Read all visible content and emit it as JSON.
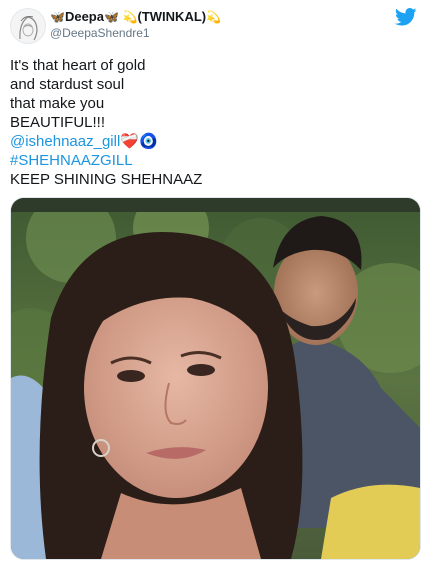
{
  "user": {
    "name_prefix_emoji": "🦋",
    "name": "Deepa",
    "name_emoji_2": "🦋",
    "name_emoji_3": "💫",
    "name_suffix": "(TWINKAL)",
    "name_emoji_4": "💫",
    "handle": "@DeepaShendre1"
  },
  "tweet": {
    "lines": [
      "It's that heart of gold",
      "and stardust soul",
      "that make you",
      "BEAUTIFUL!!!"
    ],
    "mention": "@ishehnaaz_gill",
    "mention_emojis": "❤️‍🩹🧿",
    "hashtag": "#SHEHNAAZGILL",
    "last_line": "KEEP SHINING SHEHNAAZ"
  },
  "colors": {
    "link": "#1b95e0",
    "twitter_blue": "#1da1f2"
  },
  "icons": {
    "brand": "twitter-bird-icon"
  }
}
